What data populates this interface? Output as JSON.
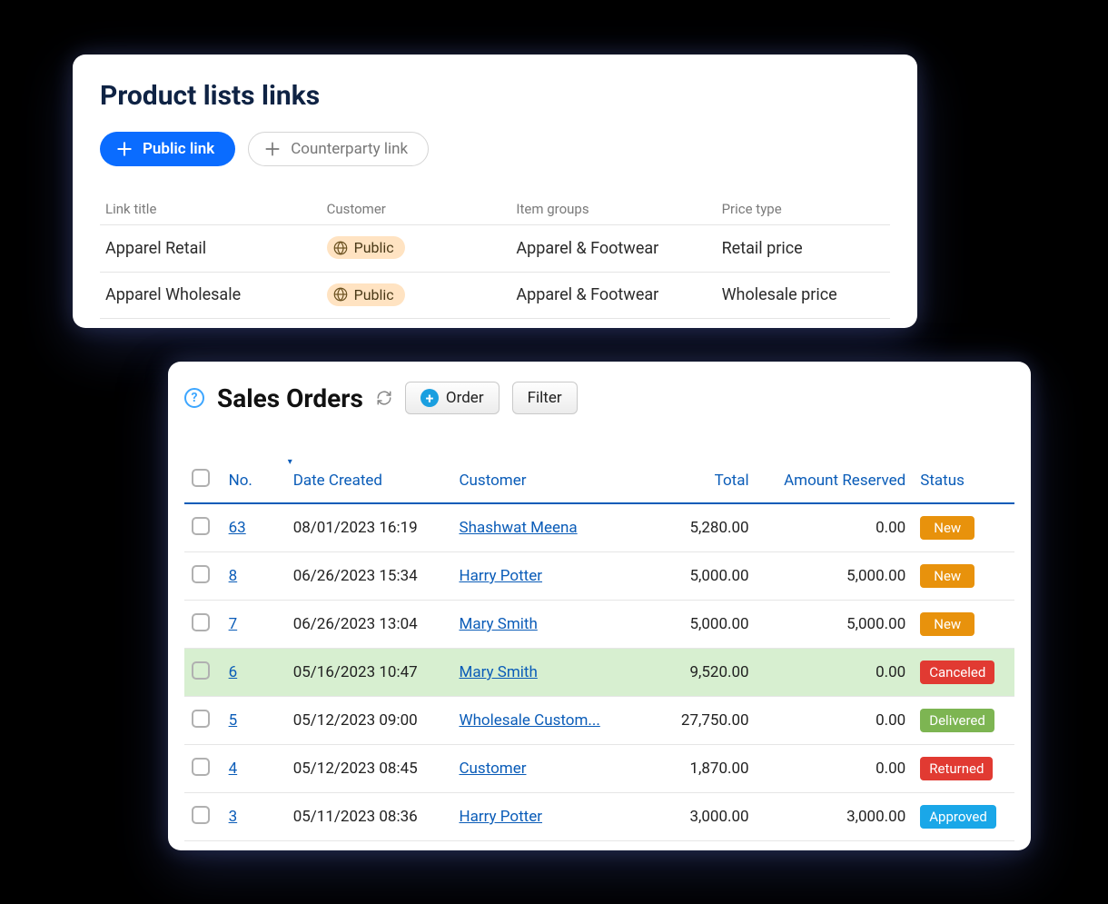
{
  "products_panel": {
    "title": "Product lists links",
    "buttons": {
      "public_link": "Public link",
      "counterparty_link": "Counterparty link"
    },
    "columns": {
      "link_title": "Link title",
      "customer": "Customer",
      "item_groups": "Item groups",
      "price_type": "Price type"
    },
    "rows": [
      {
        "title": "Apparel Retail",
        "customer_badge": "Public",
        "item_groups": "Apparel & Footwear",
        "price_type": "Retail price"
      },
      {
        "title": "Apparel Wholesale",
        "customer_badge": "Public",
        "item_groups": "Apparel & Footwear",
        "price_type": "Wholesale price"
      }
    ]
  },
  "sales_panel": {
    "title": "Sales Orders",
    "buttons": {
      "order": "Order",
      "filter": "Filter"
    },
    "columns": {
      "no": "No.",
      "date_created": "Date Created",
      "customer": "Customer",
      "total": "Total",
      "amount_reserved": "Amount Reserved",
      "status": "Status"
    },
    "rows": [
      {
        "no": "63",
        "date": "08/01/2023 16:19",
        "customer": "Shashwat Meena",
        "total": "5,280.00",
        "reserved": "0.00",
        "status": "New",
        "status_class": "status-new",
        "highlight": false
      },
      {
        "no": "8",
        "date": "06/26/2023 15:34",
        "customer": "Harry Potter",
        "total": "5,000.00",
        "reserved": "5,000.00",
        "status": "New",
        "status_class": "status-new",
        "highlight": false
      },
      {
        "no": "7",
        "date": "06/26/2023 13:04",
        "customer": "Mary Smith",
        "total": "5,000.00",
        "reserved": "5,000.00",
        "status": "New",
        "status_class": "status-new",
        "highlight": false
      },
      {
        "no": "6",
        "date": "05/16/2023 10:47",
        "customer": "Mary Smith",
        "total": "9,520.00",
        "reserved": "0.00",
        "status": "Canceled",
        "status_class": "status-canceled",
        "highlight": true
      },
      {
        "no": "5",
        "date": "05/12/2023 09:00",
        "customer": "Wholesale Custom...",
        "total": "27,750.00",
        "reserved": "0.00",
        "status": "Delivered",
        "status_class": "status-delivered",
        "highlight": false
      },
      {
        "no": "4",
        "date": "05/12/2023 08:45",
        "customer": "Customer",
        "total": "1,870.00",
        "reserved": "0.00",
        "status": "Returned",
        "status_class": "status-returned",
        "highlight": false
      },
      {
        "no": "3",
        "date": "05/11/2023 08:36",
        "customer": "Harry Potter",
        "total": "3,000.00",
        "reserved": "3,000.00",
        "status": "Approved",
        "status_class": "status-approved",
        "highlight": false
      }
    ]
  }
}
